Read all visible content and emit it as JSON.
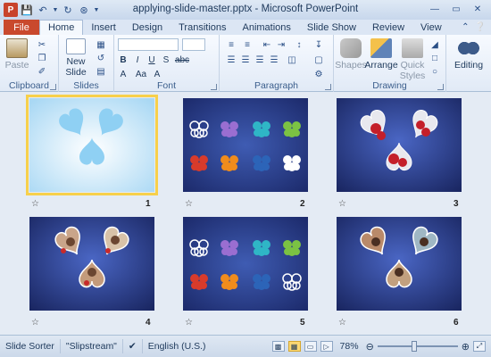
{
  "window": {
    "title": "applying-slide-master.pptx - Microsoft PowerPoint",
    "app_icon_letter": "P"
  },
  "qat": {
    "save_icon": "save-icon",
    "undo_icon": "undo-icon",
    "redo_icon": "redo-icon",
    "customize_icon": "customize-icon"
  },
  "tabs": {
    "file": "File",
    "items": [
      "Home",
      "Insert",
      "Design",
      "Transitions",
      "Animations",
      "Slide Show",
      "Review",
      "View"
    ],
    "active": "Home"
  },
  "ribbon": {
    "clipboard": {
      "label": "Clipboard",
      "paste": "Paste"
    },
    "slides": {
      "label": "Slides",
      "new_slide_line1": "New",
      "new_slide_line2": "Slide"
    },
    "font": {
      "label": "Font",
      "bold": "B",
      "italic": "I",
      "underline": "U",
      "strike": "S",
      "abc": "abc",
      "shadow": "A",
      "aa": "Aa",
      "color": "A"
    },
    "paragraph": {
      "label": "Paragraph"
    },
    "drawing": {
      "label": "Drawing",
      "shapes": "Shapes",
      "arrange": "Arrange",
      "quick_line1": "Quick",
      "quick_line2": "Styles"
    },
    "editing": {
      "label": "Editing"
    }
  },
  "slides": [
    {
      "number": "1",
      "selected": true
    },
    {
      "number": "2",
      "selected": false
    },
    {
      "number": "3",
      "selected": false
    },
    {
      "number": "4",
      "selected": false
    },
    {
      "number": "5",
      "selected": false
    },
    {
      "number": "6",
      "selected": false
    }
  ],
  "status": {
    "view": "Slide Sorter",
    "theme": "\"Slipstream\"",
    "language": "English (U.S.)",
    "zoom": "78%"
  },
  "colors": {
    "file_tab": "#c9492d",
    "selection": "#f7d04b",
    "slide_blue": "#2b3f8a"
  }
}
